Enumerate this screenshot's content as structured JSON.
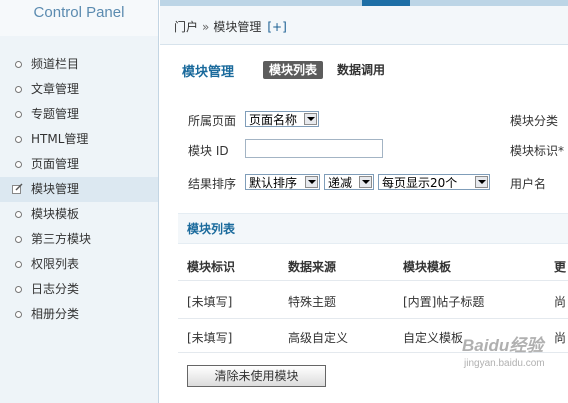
{
  "sidebar": {
    "title": "Control Panel",
    "items": [
      {
        "label": "频道栏目"
      },
      {
        "label": "文章管理"
      },
      {
        "label": "专题管理"
      },
      {
        "label": "HTML管理"
      },
      {
        "label": "页面管理"
      },
      {
        "label": "模块管理",
        "active": true
      },
      {
        "label": "模块模板"
      },
      {
        "label": "第三方模块"
      },
      {
        "label": "权限列表"
      },
      {
        "label": "日志分类"
      },
      {
        "label": "相册分类"
      }
    ]
  },
  "breadcrumb": {
    "home": "门户",
    "separator": "»",
    "current": "模块管理",
    "add": "[+]"
  },
  "header": {
    "title": "模块管理",
    "tabs": [
      "模块列表",
      "数据调用"
    ]
  },
  "filters": {
    "page_label": "所属页面",
    "page_value": "页面名称",
    "module_id_label": "模块 ID",
    "module_id_value": "",
    "sort_label": "结果排序",
    "sort_value": "默认排序",
    "order_value": "递减",
    "perpage_value": "每页显示20个",
    "category_label": "模块分类",
    "ident_label": "模块标识*",
    "user_label": "用户名"
  },
  "list": {
    "section_title": "模块列表",
    "columns": [
      "模块标识",
      "数据来源",
      "模块模板",
      "更"
    ],
    "rows": [
      [
        "[未填写]",
        "特殊主题",
        "[内置]帖子标题",
        "尚"
      ],
      [
        "[未填写]",
        "高级自定义",
        "自定义模板",
        "尚"
      ]
    ]
  },
  "actions": {
    "clear_unused": "清除未使用模块"
  },
  "watermark": {
    "brand": "Baidu经验",
    "url": "jingyan.baidu.com"
  },
  "colors": {
    "accent": "#1a6a9c",
    "sidebar_bg": "#eef4f8",
    "active_tab_bg": "#5c5c5c"
  }
}
